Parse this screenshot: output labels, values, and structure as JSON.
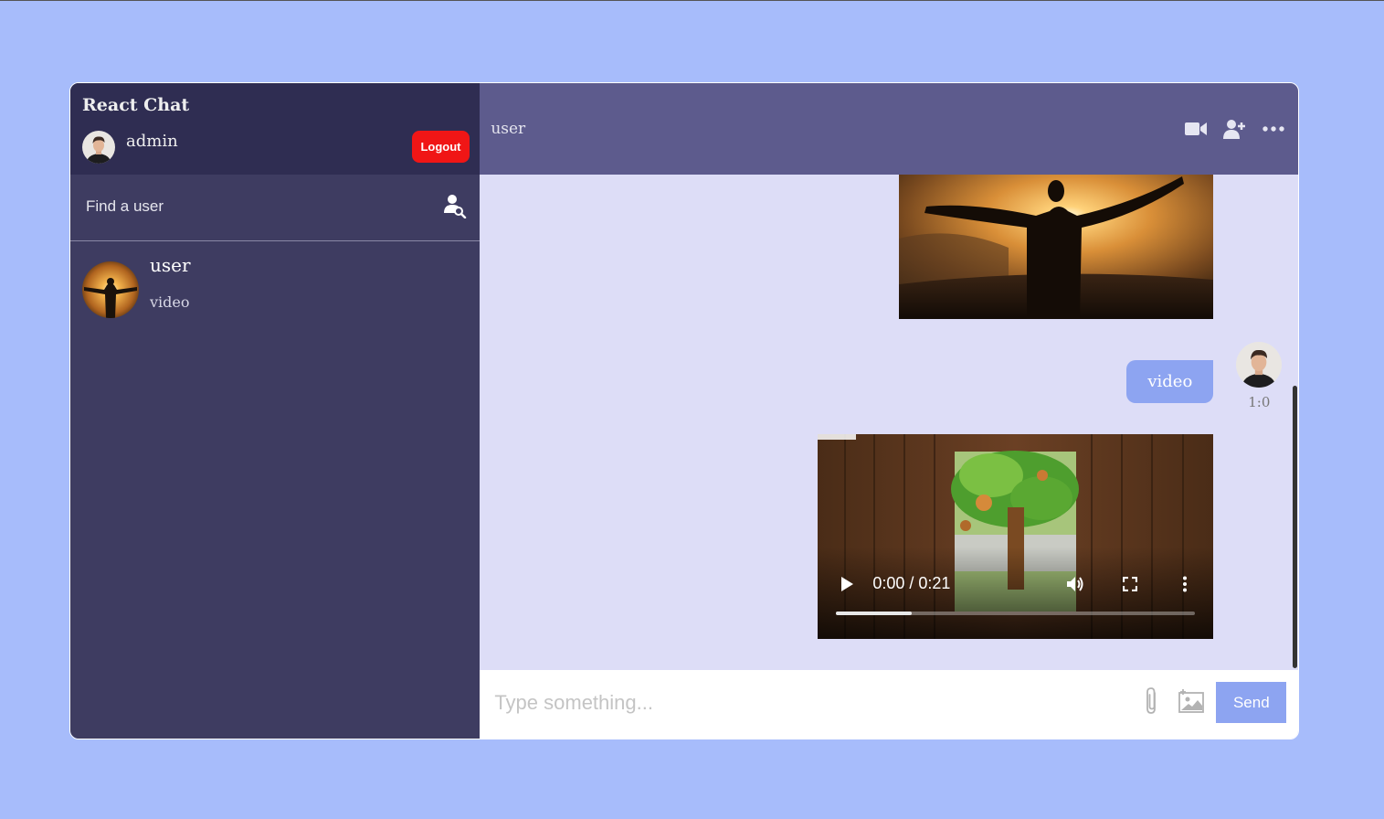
{
  "app": {
    "brand": "React Chat"
  },
  "current_user": {
    "name": "admin",
    "logout_label": "Logout"
  },
  "search": {
    "placeholder": "Find a user"
  },
  "chats": [
    {
      "name": "user",
      "last_message": "video"
    }
  ],
  "chat_header": {
    "title": "user"
  },
  "messages": {
    "text_message": "video",
    "time": "1:0",
    "video_time": "0:00 / 0:21",
    "video_progress": 0.21
  },
  "composer": {
    "placeholder": "Type something...",
    "send_label": "Send"
  },
  "colors": {
    "page_bg": "#a7bcfb",
    "sidebar_bg": "#3e3c61",
    "navbar_bg": "#2f2d52",
    "header_bg": "#5d5b8d",
    "chat_bg": "#ddddf7",
    "accent": "#8da4f1",
    "logout": "#f01616"
  },
  "icons": [
    "search-user-icon",
    "video-camera-icon",
    "add-user-icon",
    "more-icon",
    "attach-icon",
    "image-icon",
    "play-icon",
    "volume-icon",
    "fullscreen-icon",
    "video-menu-icon"
  ]
}
